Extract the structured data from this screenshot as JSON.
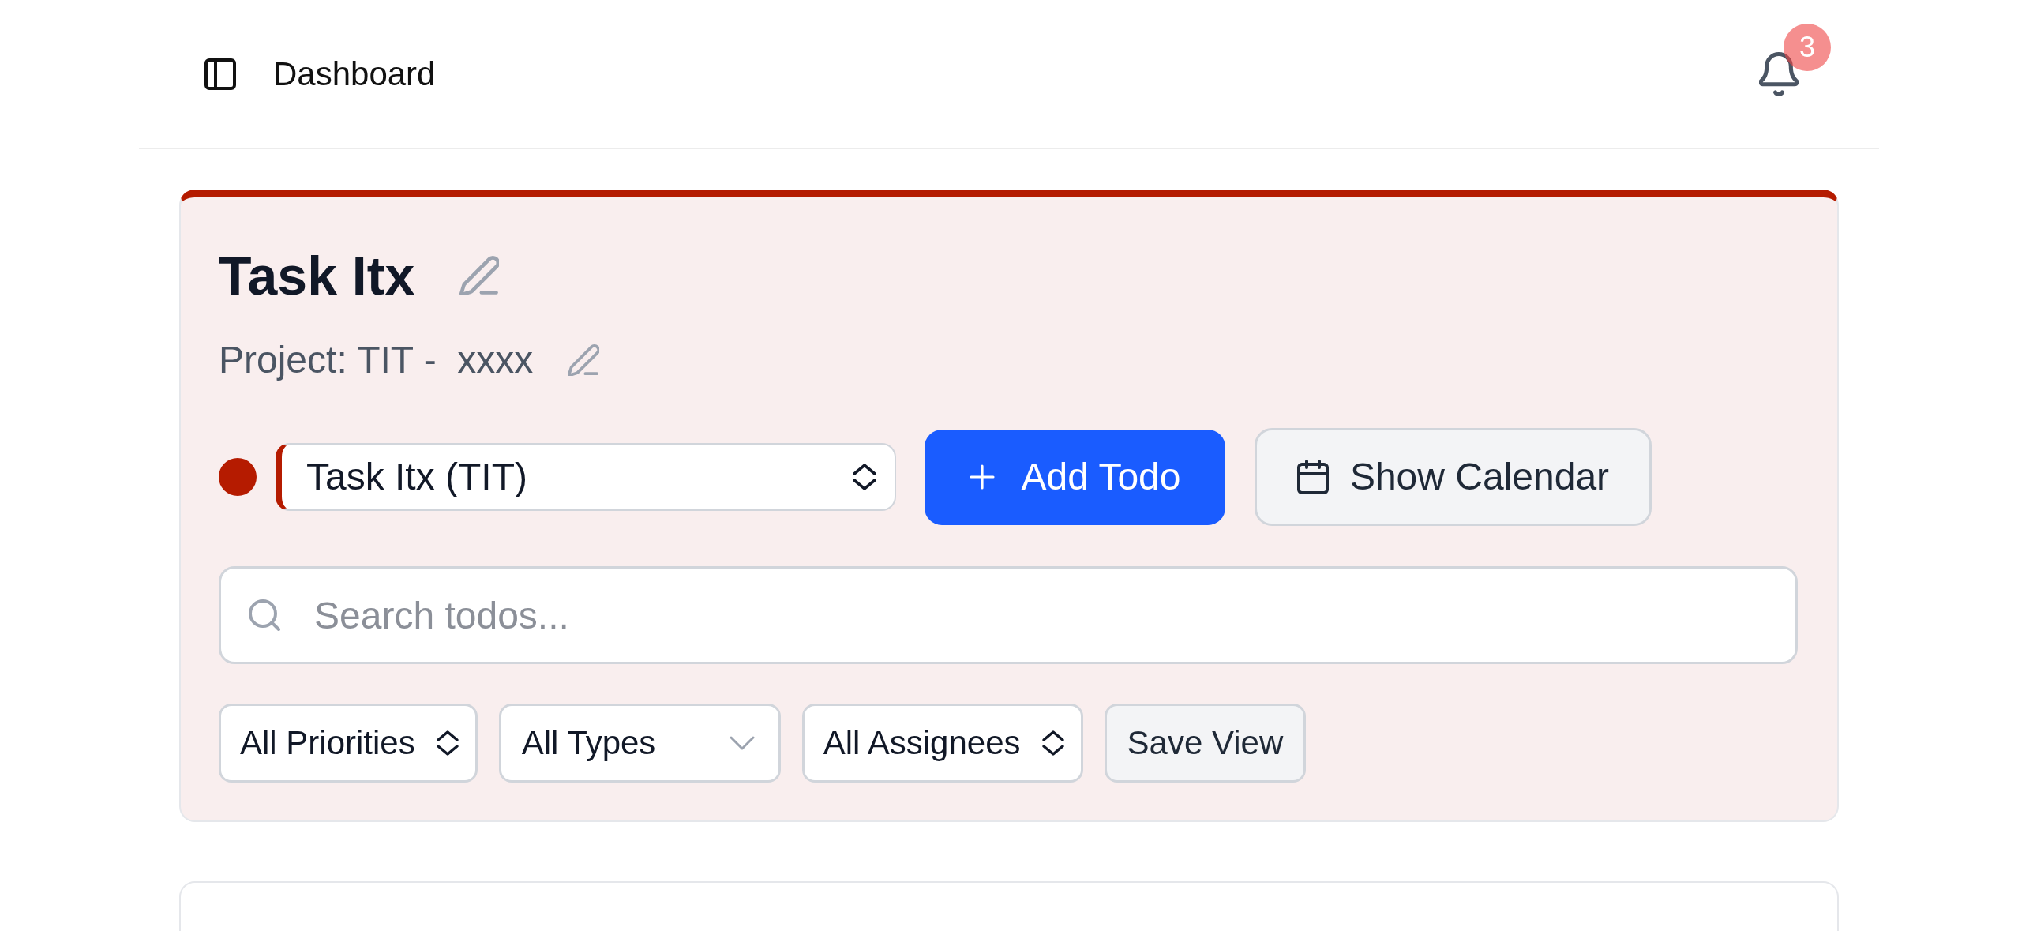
{
  "header": {
    "title": "Dashboard",
    "notification_count": "3"
  },
  "task": {
    "title": "Task Itx",
    "project": "Project: TIT -  xxxx",
    "color": "#b51b00"
  },
  "toolbar": {
    "project_select": {
      "value": "Task Itx (TIT)"
    },
    "add_button": {
      "label": "Add Todo"
    },
    "calendar_button": {
      "label": "Show Calendar"
    }
  },
  "search": {
    "placeholder": "Search todos..."
  },
  "filters": [
    {
      "kind": "select",
      "value": "All Priorities"
    },
    {
      "kind": "dropdown",
      "value": "All Types"
    },
    {
      "kind": "select",
      "value": "All Assignees"
    },
    {
      "kind": "button",
      "label": "Save View"
    }
  ]
}
